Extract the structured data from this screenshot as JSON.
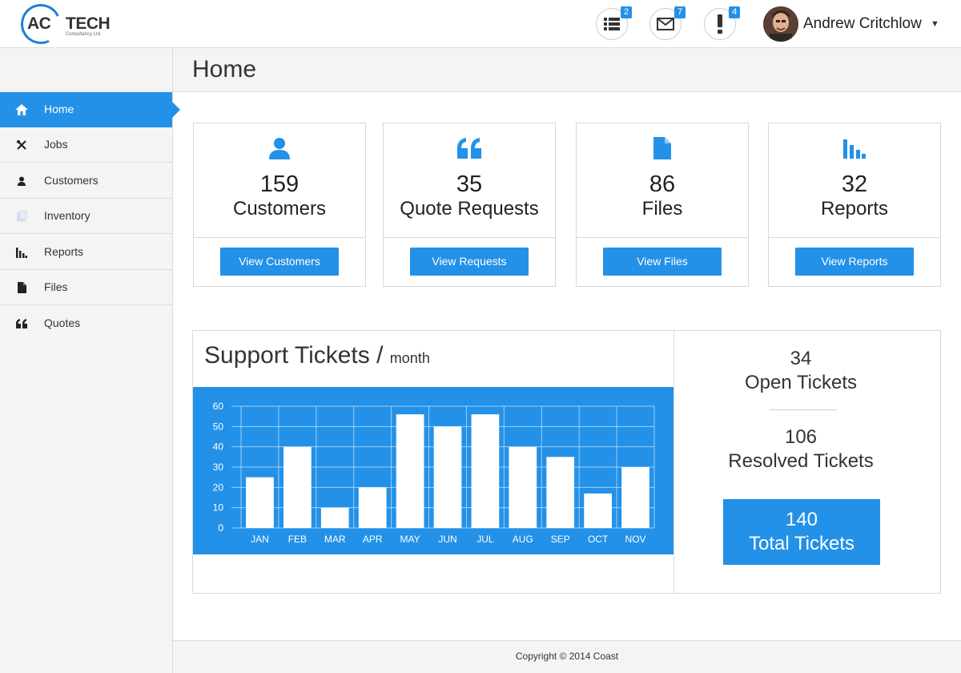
{
  "header": {
    "logo": {
      "ac": "AC",
      "tech": "TECH",
      "sub": "Consultancy Ltd."
    },
    "icons": [
      {
        "icon": "list-icon",
        "badge": "2"
      },
      {
        "icon": "envelope-icon",
        "badge": "7"
      },
      {
        "icon": "exclamation-icon",
        "badge": "4"
      }
    ],
    "user_name": "Andrew Critchlow",
    "caret": "▼"
  },
  "sidebar": {
    "items": [
      {
        "label": "Home",
        "icon": "home-icon",
        "active": true
      },
      {
        "label": "Jobs",
        "icon": "tools-icon"
      },
      {
        "label": "Customers",
        "icon": "user-icon"
      },
      {
        "label": "Inventory",
        "icon": "inventory-icon"
      },
      {
        "label": "Reports",
        "icon": "bar-chart-icon"
      },
      {
        "label": "Files",
        "icon": "file-icon"
      },
      {
        "label": "Quotes",
        "icon": "quote-icon"
      }
    ]
  },
  "page": {
    "title": "Home"
  },
  "cards": [
    {
      "count": "159",
      "label": "Customers",
      "button": "View Customers",
      "icon": "user-icon"
    },
    {
      "count": "35",
      "label": "Quote Requests",
      "button": "View Requests",
      "icon": "quote-icon"
    },
    {
      "count": "86",
      "label": "Files",
      "button": "View Files",
      "icon": "file-icon"
    },
    {
      "count": "32",
      "label": "Reports",
      "button": "View Reports",
      "icon": "bar-chart-icon"
    }
  ],
  "tickets": {
    "title": "Support Tickets",
    "slash": "/",
    "subtitle": "month",
    "open_count": "34",
    "open_label": "Open Tickets",
    "resolved_count": "106",
    "resolved_label": "Resolved Tickets",
    "total_count": "140",
    "total_label": "Total Tickets"
  },
  "chart_data": {
    "type": "bar",
    "categories": [
      "JAN",
      "FEB",
      "MAR",
      "APR",
      "MAY",
      "JUN",
      "JUL",
      "AUG",
      "SEP",
      "OCT",
      "NOV"
    ],
    "values": [
      25,
      40,
      10,
      20,
      56,
      50,
      56,
      40,
      35,
      17,
      30
    ],
    "ylim": [
      0,
      60
    ],
    "yticks": [
      0,
      10,
      20,
      30,
      40,
      50,
      60
    ],
    "grid": true,
    "bar_color": "#ffffff",
    "background": "#2391e8"
  },
  "footer": {
    "text": "Copyright © 2014 Coast"
  },
  "colors": {
    "accent": "#2391e8"
  }
}
